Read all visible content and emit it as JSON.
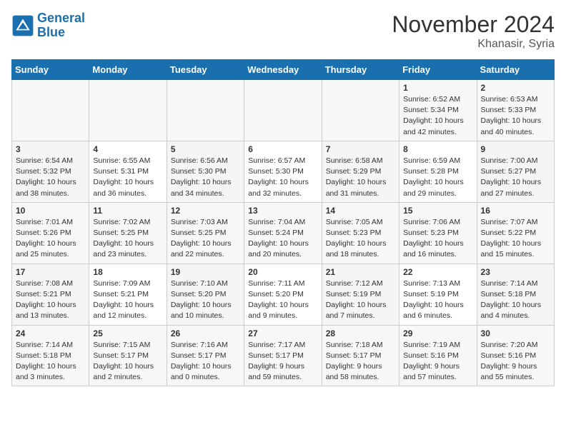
{
  "header": {
    "logo_line1": "General",
    "logo_line2": "Blue",
    "month": "November 2024",
    "location": "Khanasir, Syria"
  },
  "days_of_week": [
    "Sunday",
    "Monday",
    "Tuesday",
    "Wednesday",
    "Thursday",
    "Friday",
    "Saturday"
  ],
  "weeks": [
    [
      {
        "day": "",
        "info": ""
      },
      {
        "day": "",
        "info": ""
      },
      {
        "day": "",
        "info": ""
      },
      {
        "day": "",
        "info": ""
      },
      {
        "day": "",
        "info": ""
      },
      {
        "day": "1",
        "info": "Sunrise: 6:52 AM\nSunset: 5:34 PM\nDaylight: 10 hours and 42 minutes."
      },
      {
        "day": "2",
        "info": "Sunrise: 6:53 AM\nSunset: 5:33 PM\nDaylight: 10 hours and 40 minutes."
      }
    ],
    [
      {
        "day": "3",
        "info": "Sunrise: 6:54 AM\nSunset: 5:32 PM\nDaylight: 10 hours and 38 minutes."
      },
      {
        "day": "4",
        "info": "Sunrise: 6:55 AM\nSunset: 5:31 PM\nDaylight: 10 hours and 36 minutes."
      },
      {
        "day": "5",
        "info": "Sunrise: 6:56 AM\nSunset: 5:30 PM\nDaylight: 10 hours and 34 minutes."
      },
      {
        "day": "6",
        "info": "Sunrise: 6:57 AM\nSunset: 5:30 PM\nDaylight: 10 hours and 32 minutes."
      },
      {
        "day": "7",
        "info": "Sunrise: 6:58 AM\nSunset: 5:29 PM\nDaylight: 10 hours and 31 minutes."
      },
      {
        "day": "8",
        "info": "Sunrise: 6:59 AM\nSunset: 5:28 PM\nDaylight: 10 hours and 29 minutes."
      },
      {
        "day": "9",
        "info": "Sunrise: 7:00 AM\nSunset: 5:27 PM\nDaylight: 10 hours and 27 minutes."
      }
    ],
    [
      {
        "day": "10",
        "info": "Sunrise: 7:01 AM\nSunset: 5:26 PM\nDaylight: 10 hours and 25 minutes."
      },
      {
        "day": "11",
        "info": "Sunrise: 7:02 AM\nSunset: 5:25 PM\nDaylight: 10 hours and 23 minutes."
      },
      {
        "day": "12",
        "info": "Sunrise: 7:03 AM\nSunset: 5:25 PM\nDaylight: 10 hours and 22 minutes."
      },
      {
        "day": "13",
        "info": "Sunrise: 7:04 AM\nSunset: 5:24 PM\nDaylight: 10 hours and 20 minutes."
      },
      {
        "day": "14",
        "info": "Sunrise: 7:05 AM\nSunset: 5:23 PM\nDaylight: 10 hours and 18 minutes."
      },
      {
        "day": "15",
        "info": "Sunrise: 7:06 AM\nSunset: 5:23 PM\nDaylight: 10 hours and 16 minutes."
      },
      {
        "day": "16",
        "info": "Sunrise: 7:07 AM\nSunset: 5:22 PM\nDaylight: 10 hours and 15 minutes."
      }
    ],
    [
      {
        "day": "17",
        "info": "Sunrise: 7:08 AM\nSunset: 5:21 PM\nDaylight: 10 hours and 13 minutes."
      },
      {
        "day": "18",
        "info": "Sunrise: 7:09 AM\nSunset: 5:21 PM\nDaylight: 10 hours and 12 minutes."
      },
      {
        "day": "19",
        "info": "Sunrise: 7:10 AM\nSunset: 5:20 PM\nDaylight: 10 hours and 10 minutes."
      },
      {
        "day": "20",
        "info": "Sunrise: 7:11 AM\nSunset: 5:20 PM\nDaylight: 10 hours and 9 minutes."
      },
      {
        "day": "21",
        "info": "Sunrise: 7:12 AM\nSunset: 5:19 PM\nDaylight: 10 hours and 7 minutes."
      },
      {
        "day": "22",
        "info": "Sunrise: 7:13 AM\nSunset: 5:19 PM\nDaylight: 10 hours and 6 minutes."
      },
      {
        "day": "23",
        "info": "Sunrise: 7:14 AM\nSunset: 5:18 PM\nDaylight: 10 hours and 4 minutes."
      }
    ],
    [
      {
        "day": "24",
        "info": "Sunrise: 7:14 AM\nSunset: 5:18 PM\nDaylight: 10 hours and 3 minutes."
      },
      {
        "day": "25",
        "info": "Sunrise: 7:15 AM\nSunset: 5:17 PM\nDaylight: 10 hours and 2 minutes."
      },
      {
        "day": "26",
        "info": "Sunrise: 7:16 AM\nSunset: 5:17 PM\nDaylight: 10 hours and 0 minutes."
      },
      {
        "day": "27",
        "info": "Sunrise: 7:17 AM\nSunset: 5:17 PM\nDaylight: 9 hours and 59 minutes."
      },
      {
        "day": "28",
        "info": "Sunrise: 7:18 AM\nSunset: 5:17 PM\nDaylight: 9 hours and 58 minutes."
      },
      {
        "day": "29",
        "info": "Sunrise: 7:19 AM\nSunset: 5:16 PM\nDaylight: 9 hours and 57 minutes."
      },
      {
        "day": "30",
        "info": "Sunrise: 7:20 AM\nSunset: 5:16 PM\nDaylight: 9 hours and 55 minutes."
      }
    ]
  ]
}
